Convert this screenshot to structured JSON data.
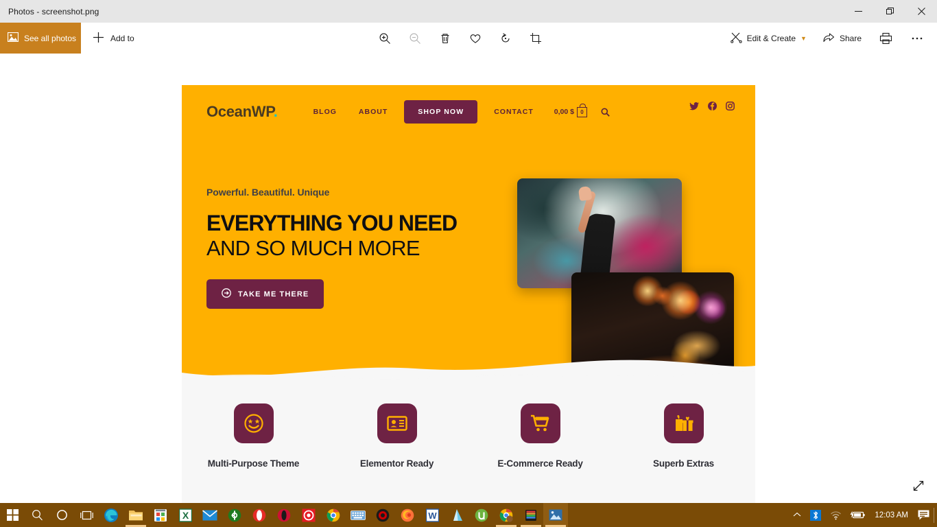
{
  "window": {
    "title": "Photos - screenshot.png",
    "controls": {
      "minimize": "minimize-icon",
      "maximize": "restore-icon",
      "close": "close-icon"
    }
  },
  "toolbar": {
    "see_all_photos": "See all photos",
    "add_to": "Add to",
    "center_tools": [
      {
        "name": "zoom-in-icon",
        "label": "Zoom in",
        "disabled": false
      },
      {
        "name": "zoom-out-icon",
        "label": "Zoom out",
        "disabled": true
      },
      {
        "name": "delete-icon",
        "label": "Delete",
        "disabled": false
      },
      {
        "name": "favorite-icon",
        "label": "Add to favorites",
        "disabled": false
      },
      {
        "name": "rotate-icon",
        "label": "Rotate",
        "disabled": false
      },
      {
        "name": "crop-icon",
        "label": "Crop and rotate",
        "disabled": false
      }
    ],
    "edit_create": "Edit & Create",
    "share": "Share",
    "print": "Print",
    "more": "See more"
  },
  "site": {
    "logo": {
      "text": "OceanWP",
      "dot": ".",
      "dot_color": "#19c5c5"
    },
    "nav": [
      {
        "label": "BLOG"
      },
      {
        "label": "ABOUT"
      }
    ],
    "nav_after": [
      {
        "label": "CONTACT"
      }
    ],
    "shop_now": "SHOP NOW",
    "cart": {
      "price": "0,00 $",
      "count": "0"
    },
    "search": "search-icon",
    "socials": [
      {
        "name": "twitter-icon"
      },
      {
        "name": "facebook-icon"
      },
      {
        "name": "instagram-icon"
      }
    ],
    "hero": {
      "eyebrow": "Powerful. Beautiful. Unique",
      "headline_bold": "EVERYTHING YOU NEED",
      "headline_light": "AND SO MUCH MORE",
      "cta": "TAKE ME THERE"
    },
    "features": [
      {
        "icon": "smiley-star-eyes-icon",
        "label": "Multi-Purpose Theme"
      },
      {
        "icon": "id-card-icon",
        "label": "Elementor Ready"
      },
      {
        "icon": "shopping-cart-icon",
        "label": "E-Commerce Ready"
      },
      {
        "icon": "gift-boxes-icon",
        "label": "Superb Extras"
      }
    ],
    "colors": {
      "hero_background": "#FFB000",
      "accent_plum": "#6E2244",
      "features_background": "#F7F7F7"
    }
  },
  "viewer": {
    "expand": "expand-fullscreen-icon"
  },
  "taskbar": {
    "items": [
      {
        "name": "start-button"
      },
      {
        "name": "search-button"
      },
      {
        "name": "cortana-button"
      },
      {
        "name": "task-view-button"
      },
      {
        "name": "edge-icon"
      },
      {
        "name": "file-explorer-icon",
        "running": true
      },
      {
        "name": "microsoft-store-icon"
      },
      {
        "name": "excel-icon"
      },
      {
        "name": "mail-icon"
      },
      {
        "name": "ubuntu-icon"
      },
      {
        "name": "opera-icon"
      },
      {
        "name": "opera-gx-icon"
      },
      {
        "name": "screen-recorder-icon"
      },
      {
        "name": "chrome-icon"
      },
      {
        "name": "onscreen-keyboard-icon"
      },
      {
        "name": "obs-icon"
      },
      {
        "name": "firefox-icon"
      },
      {
        "name": "word-icon"
      },
      {
        "name": "azure-data-studio-icon"
      },
      {
        "name": "utorrent-icon"
      },
      {
        "name": "chrome-beta-icon",
        "running": true
      },
      {
        "name": "winrar-icon",
        "running": true
      },
      {
        "name": "photos-icon",
        "active": true,
        "running": true
      }
    ],
    "tray": {
      "show_hidden": "chevron-up-icon",
      "bluetooth": "bluetooth-icon",
      "network": "wifi-icon",
      "battery": "battery-charging-icon",
      "clock": "12:03 AM",
      "action_center": "action-center-icon"
    }
  }
}
